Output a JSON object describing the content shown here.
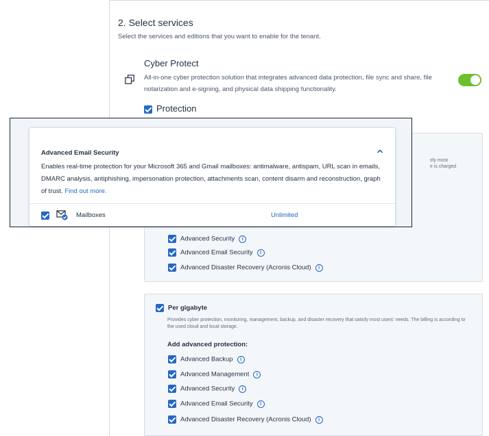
{
  "step": {
    "title": "2. Select services",
    "description": "Select the services and editions that you want to enable for the tenant."
  },
  "service": {
    "name": "Cyber Protect",
    "description": "All-in-one cyber protection solution that integrates advanced data protection, file sync and share, file notarization and e-signing, and physical data shipping functionality.",
    "enabled": true,
    "icon": "copy-squares-icon"
  },
  "protection": {
    "label": "Protection",
    "checked": true
  },
  "box1": {
    "peek_line1": "sfy most",
    "peek_line2": "e is charged",
    "items": [
      {
        "label": "Advanced Security",
        "checked": true
      },
      {
        "label": "Advanced Email Security",
        "checked": true
      },
      {
        "label": "Advanced Disaster Recovery (Acronis Cloud)",
        "checked": true
      }
    ]
  },
  "per_gigabyte": {
    "title": "Per gigabyte",
    "checked": true,
    "description": "Provides cyber protection, monitoring, management, backup, and disaster recovery that satisfy most users' needs. The billing is according to the used cloud and local storage.",
    "subheading": "Add advanced protection:",
    "items": [
      {
        "label": "Advanced Backup",
        "checked": true
      },
      {
        "label": "Advanced Management",
        "checked": true
      },
      {
        "label": "Advanced Security",
        "checked": true
      },
      {
        "label": "Advanced Email Security",
        "checked": true
      },
      {
        "label": "Advanced Disaster Recovery (Acronis Cloud)",
        "checked": true
      }
    ]
  },
  "popup": {
    "title": "Advanced Email Security",
    "description": "Enables real-time protection for your Microsoft 365 and Gmail mailboxes: antimalware, antispam, URL scan in emails, DMARC analysis, antiphishing, impersonation protection, attachments scan, content disarm and reconstruction, graph of trust.",
    "link_text": "Find out more.",
    "row": {
      "label": "Mailboxes",
      "value": "Unlimited",
      "checked": true,
      "icon": "mailbox-shield-icon"
    },
    "chevron_icon": "chevron-up-icon"
  },
  "colors": {
    "accent": "#2668c5",
    "toggle_on": "#6dbf2c",
    "text": "#243143"
  }
}
